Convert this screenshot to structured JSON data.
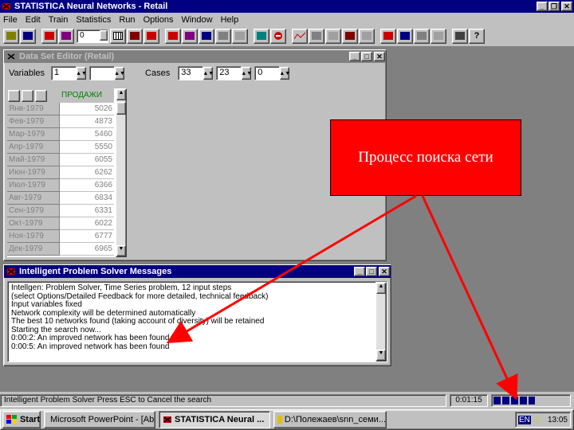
{
  "app": {
    "title": "STATISTICA Neural Networks - Retail"
  },
  "menu": [
    "File",
    "Edit",
    "Train",
    "Statistics",
    "Run",
    "Options",
    "Window",
    "Help"
  ],
  "toolbar": {
    "combo_value": "0"
  },
  "dataset_editor": {
    "title": "Data Set Editor (Retail)",
    "variables_label": "Variables",
    "variables_value": "1",
    "cases_label": "Cases",
    "cases_values": [
      "33",
      "23",
      "0"
    ],
    "column_header": "ПРОДАЖИ",
    "rows": [
      {
        "label": "Янв-1979",
        "value": "5026"
      },
      {
        "label": "Фев-1979",
        "value": "4873"
      },
      {
        "label": "Мар-1979",
        "value": "5460"
      },
      {
        "label": "Апр-1979",
        "value": "5550"
      },
      {
        "label": "Май-1979",
        "value": "6055"
      },
      {
        "label": "Июн-1979",
        "value": "6262"
      },
      {
        "label": "Июл-1979",
        "value": "6366"
      },
      {
        "label": "Авг-1979",
        "value": "6834"
      },
      {
        "label": "Сен-1979",
        "value": "6331"
      },
      {
        "label": "Окт-1979",
        "value": "6022"
      },
      {
        "label": "Ноя-1979",
        "value": "6777"
      },
      {
        "label": "Дек-1979",
        "value": "6965"
      }
    ]
  },
  "messages": {
    "title": "Intelligent Problem Solver Messages",
    "lines": [
      "Intellgen: Problem Solver, Time Series problem, 12 input steps",
      "(select Options/Detailed Feedback for more detailed, technical feedback)",
      "Input variables fixed",
      "Network complexity will be determined automatically",
      "The best 10 networks found (taking account of diversity) will be retained",
      "Starting the search now...",
      "0:00:2: An improved network has been found",
      "0:00:5: An improved network has been found"
    ]
  },
  "statusbar": {
    "text": "Intelligent Problem Solver Press ESC to Cancel the search",
    "time": "0:01:15",
    "progress": 0.55
  },
  "taskbar": {
    "start": "Start",
    "tasks": [
      "Microsoft PowerPoint - [Ab...",
      "STATISTICA Neural ...",
      "D:\\Полежаев\\snn_семи..."
    ],
    "lang": "EN",
    "clock": "13:05"
  },
  "callout": {
    "text": "Процесс поиска сети"
  },
  "colors": {
    "titlebar": "#000080",
    "callout": "#ff0000",
    "desktop": "#808080",
    "arrow": "#ff0000"
  }
}
